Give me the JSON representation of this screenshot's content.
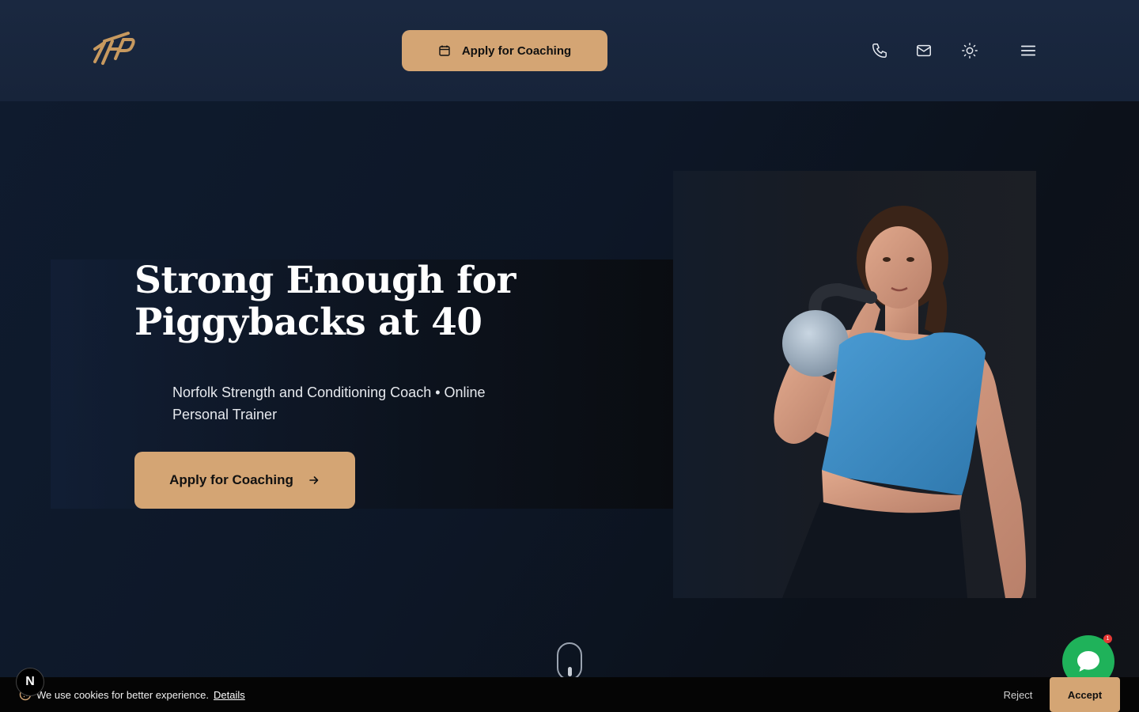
{
  "header": {
    "cta_label": "Apply for Coaching",
    "icons": [
      "phone-icon",
      "mail-icon",
      "sun-icon",
      "menu-icon"
    ]
  },
  "hero": {
    "headline_line1": "Strong Enough for",
    "headline_line2": "Piggybacks at 40",
    "subtitle_line1": "Norfolk Strength and Conditioning Coach • Online",
    "subtitle_line2": "Personal Trainer",
    "cta_label": "Apply for Coaching"
  },
  "chat": {
    "badge": "1"
  },
  "cookie": {
    "text": "We use cookies for better experience.",
    "details_label": "Details",
    "reject_label": "Reject",
    "accept_label": "Accept"
  },
  "dev_badge": {
    "label": "N"
  },
  "colors": {
    "accent": "#d4a574",
    "header_bg": "#1a2840",
    "hero_bg": "#0d1727",
    "chat_green": "#1fb25a",
    "shirt_blue": "#3a8ac2"
  }
}
